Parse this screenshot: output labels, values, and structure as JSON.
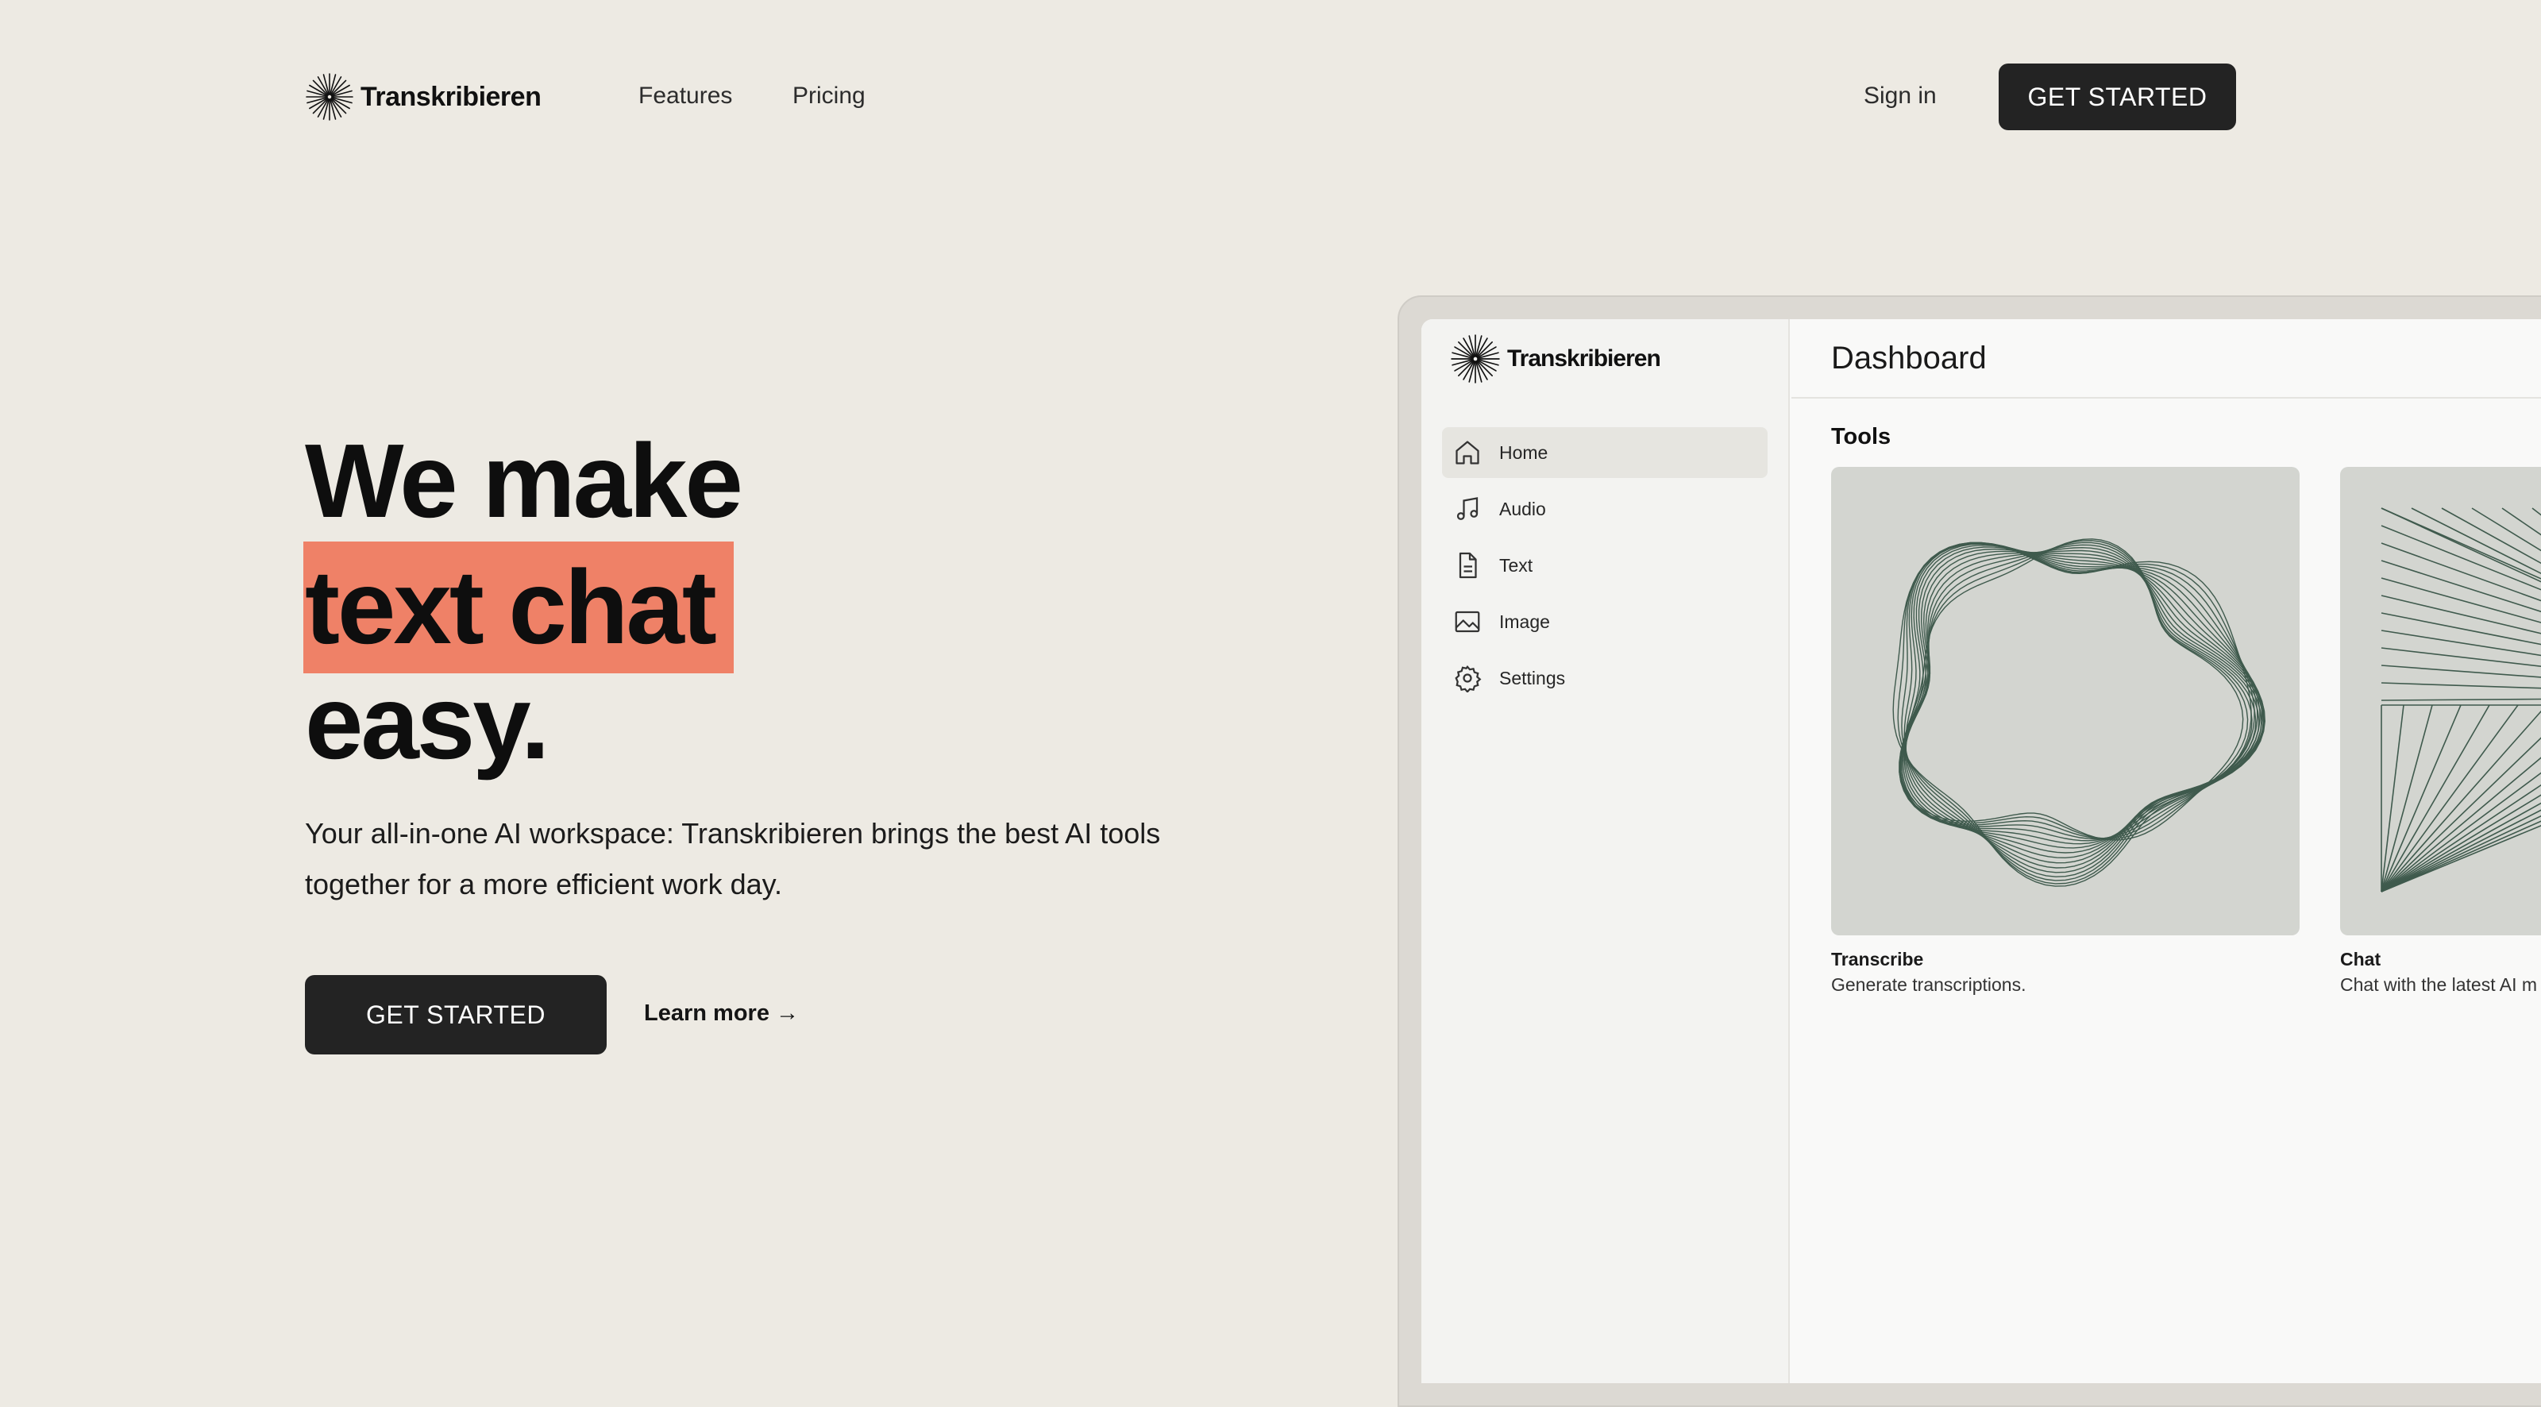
{
  "nav": {
    "brand": "Transkribieren",
    "links": [
      "Features",
      "Pricing"
    ],
    "sign_in": "Sign in",
    "cta": "GET STARTED"
  },
  "hero": {
    "title_line1": "We make",
    "title_highlight": "text chat",
    "title_line3": "easy.",
    "subtitle": "Your all-in-one AI workspace: Transkribieren brings the best AI tools together for a more efficient work day.",
    "cta": "GET STARTED",
    "learn_more": "Learn more →",
    "highlight_color": "#ef8167"
  },
  "app": {
    "brand": "Transkribieren",
    "menu": [
      {
        "label": "Home",
        "icon": "home-icon",
        "active": true
      },
      {
        "label": "Audio",
        "icon": "music-note-icon",
        "active": false
      },
      {
        "label": "Text",
        "icon": "document-icon",
        "active": false
      },
      {
        "label": "Image",
        "icon": "image-icon",
        "active": false
      },
      {
        "label": "Settings",
        "icon": "gear-icon",
        "active": false
      }
    ],
    "page_title": "Dashboard",
    "section": "Tools",
    "tools": [
      {
        "name": "Transcribe",
        "description": "Generate transcriptions."
      },
      {
        "name": "Chat",
        "description": "Chat with the latest AI m"
      }
    ]
  },
  "colors": {
    "background": "#edeae3",
    "button": "#232323",
    "accent": "#ef8167",
    "card_art": "#d3d5d0",
    "art_stroke": "#3f5a4d"
  }
}
